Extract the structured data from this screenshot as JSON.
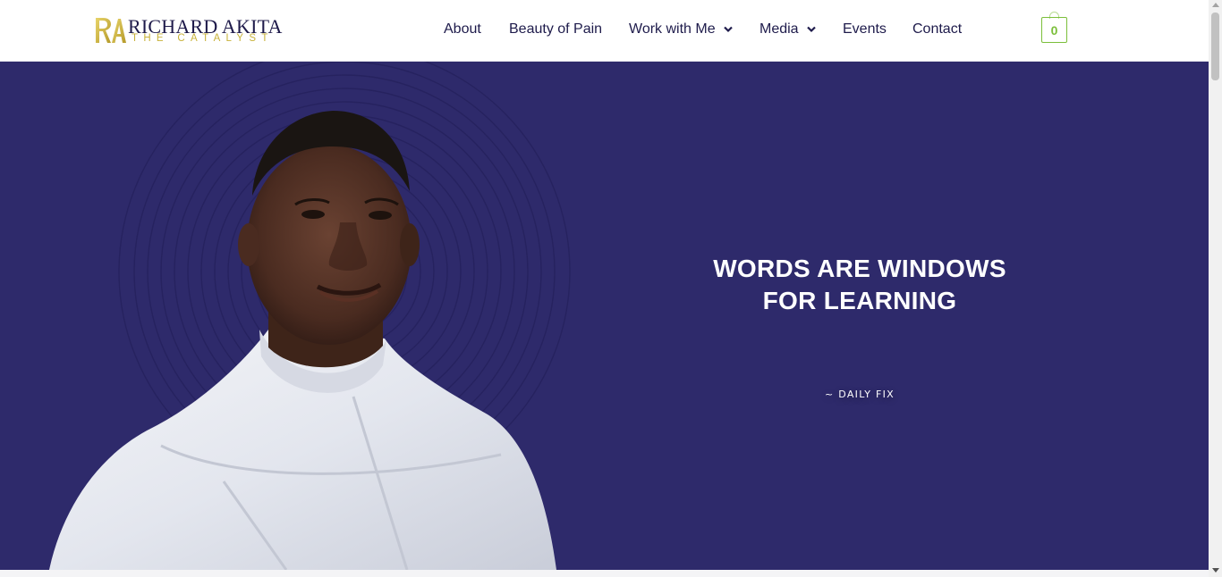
{
  "header": {
    "logo": {
      "name": "RICHARD AKITA",
      "tagline": "THE CATALYST",
      "monogram": "RA"
    },
    "nav": [
      {
        "label": "About",
        "has_dropdown": false
      },
      {
        "label": "Beauty of Pain",
        "has_dropdown": false
      },
      {
        "label": "Work with Me",
        "has_dropdown": true
      },
      {
        "label": "Media",
        "has_dropdown": true
      },
      {
        "label": "Events",
        "has_dropdown": false
      },
      {
        "label": "Contact",
        "has_dropdown": false
      }
    ],
    "cart": {
      "count": "0",
      "icon": "shopping-bag-icon"
    }
  },
  "hero": {
    "quote_line1": "WORDS ARE WINDOWS",
    "quote_line2": "FOR LEARNING",
    "source": "~ DAILY FIX"
  },
  "colors": {
    "nav_text": "#1e1b4b",
    "hero_bg": "#2e2a6b",
    "accent_gold": "#c8b23a",
    "cart_green": "#7bbf3a"
  }
}
